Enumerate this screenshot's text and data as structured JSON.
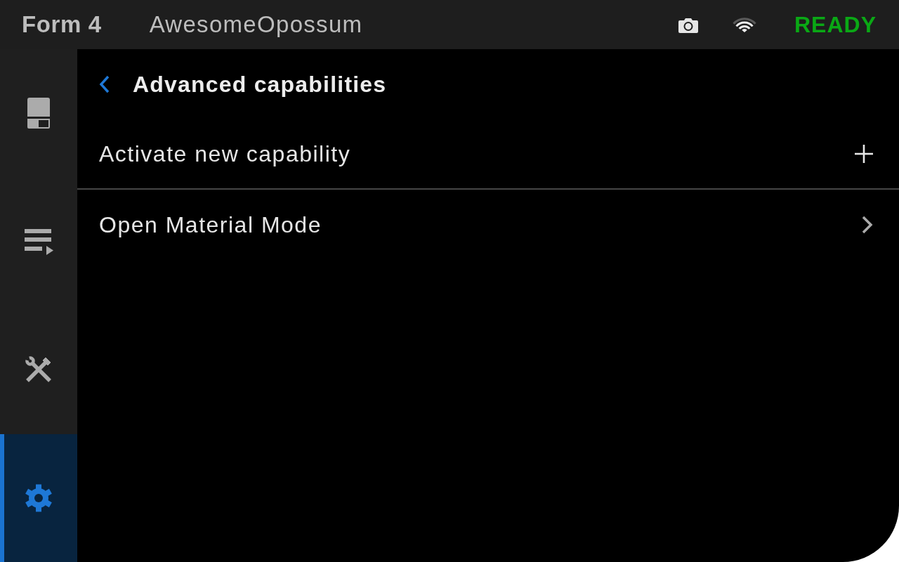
{
  "top_bar": {
    "printer_model": "Form 4",
    "printer_name": "AwesomeOpossum",
    "status": "READY"
  },
  "sidebar": {
    "items": [
      {
        "selected": false
      },
      {
        "selected": false
      },
      {
        "selected": false
      },
      {
        "selected": true
      }
    ]
  },
  "page": {
    "title": "Advanced capabilities"
  },
  "menu": [
    {
      "kind": "action",
      "label": "Activate new capability"
    },
    {
      "kind": "navigate",
      "label": "Open Material Mode"
    }
  ]
}
